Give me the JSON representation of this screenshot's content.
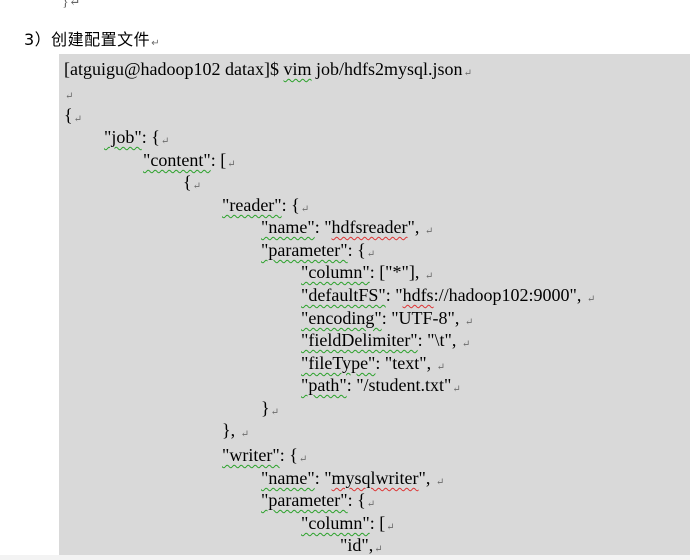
{
  "top_fragment": "}↵",
  "heading": "3）创建配置文件",
  "paragraph_mark": "↵",
  "command": {
    "prompt": "[atguigu@hadoop102 datax]$ ",
    "vim": "vim",
    "path": " job/hdfs2mysql.json"
  },
  "json": {
    "open_brace": "{",
    "job_key": "\"job\"",
    "job_rest": ": {",
    "content_key": "\"content\"",
    "content_rest": ": [",
    "content_open": "{",
    "reader_key": "\"reader\"",
    "reader_rest": ": {",
    "reader_name_key": "\"name\"",
    "reader_name_sep": ": \"",
    "reader_name_val": "hdfsreader",
    "reader_name_end": "\",",
    "param_key": "\"parameter\"",
    "param_rest": ": {",
    "column_key": "\"column\"",
    "column_rest": ": [\"*\"],",
    "defaultfs_key": "\"defaultFS\"",
    "defaultfs_sep": ": \"",
    "defaultfs_val": "hdfs",
    "defaultfs_rest": "://hadoop102:9000\",",
    "encoding_key": "\"encoding\"",
    "encoding_rest": ": \"UTF-8\",",
    "fielddelim_key": "\"fieldDelimiter\"",
    "fielddelim_rest": ": \"\\t\",",
    "filetype_key": "\"fileType\"",
    "filetype_rest": ": \"text\",",
    "path_key": "\"path\"",
    "path_rest": ": \"/student.txt\"",
    "param_close": "}",
    "reader_close": "},",
    "writer_key": "\"writer\"",
    "writer_rest": ": {",
    "writer_name_key": "\"name\"",
    "writer_name_sep": ": \"",
    "writer_name_val": "mysqlwriter",
    "writer_name_end": "\",",
    "writer_param_key": "\"parameter\"",
    "writer_param_rest": ": {",
    "writer_column_key": "\"column\"",
    "writer_column_rest": ": [",
    "id_value": "\"id\","
  }
}
